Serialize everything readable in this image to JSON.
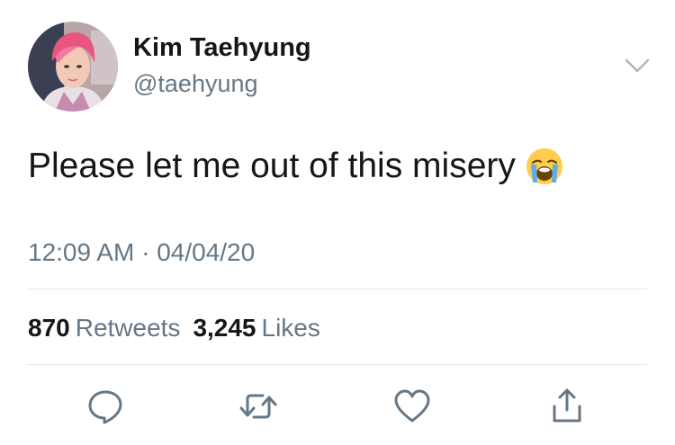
{
  "author": {
    "display_name": "Kim Taehyung",
    "handle": "@taehyung",
    "avatar_icon": "profile-photo"
  },
  "tweet": {
    "text": "Please let me out of this misery",
    "emoji": "loudly-crying-face",
    "time": "12:09 AM",
    "separator": "·",
    "date": "04/04/20"
  },
  "stats": {
    "retweets_count": "870",
    "retweets_label": "Retweets",
    "likes_count": "3,245",
    "likes_label": "Likes"
  },
  "actions": {
    "reply_icon": "reply-icon",
    "retweet_icon": "retweet-icon",
    "like_icon": "like-icon",
    "share_icon": "share-icon"
  },
  "colors": {
    "primary_text": "#14171a",
    "secondary_text": "#657786",
    "divider": "#e1e8ed",
    "icon": "#657786"
  }
}
